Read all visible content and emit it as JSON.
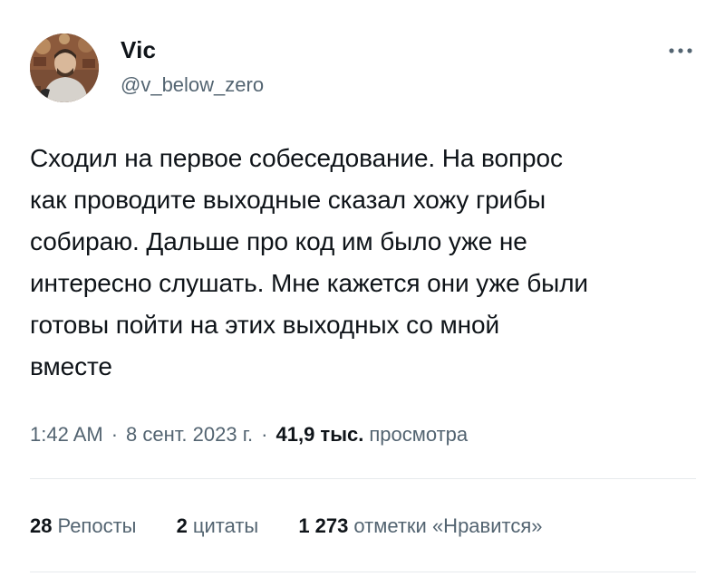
{
  "author": {
    "display_name": "Vic",
    "handle": "@v_below_zero"
  },
  "tweet": {
    "text": "Сходил на первое собеседование. На вопрос\nкак проводите выходные сказал хожу грибы\nсобираю. Дальше про код им было уже не\nинтересно слушать. Мне кажется они уже были\nготовы пойти на этих выходных со мной\nвместе",
    "time": "1:42 AM",
    "separator": "·",
    "date": "8 сент. 2023 г.",
    "views_count": "41,9 тыс.",
    "views_label": "просмотра"
  },
  "stats": {
    "reposts_count": "28",
    "reposts_label": "Репосты",
    "quotes_count": "2",
    "quotes_label": "цитаты",
    "likes_count": "1 273",
    "likes_label": "отметки «Нравится»"
  },
  "icons": {
    "more": "more-horizontal-icon"
  },
  "colors": {
    "text_primary": "#0f1419",
    "text_secondary": "#536471",
    "divider": "#e6eaed"
  }
}
